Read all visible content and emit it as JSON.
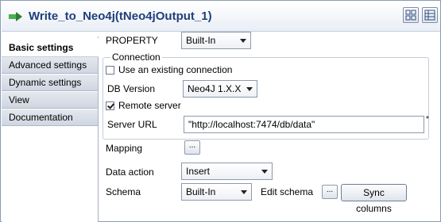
{
  "window": {
    "title": "Write_to_Neo4j(tNeo4jOutput_1)"
  },
  "tabs": [
    {
      "label": "Basic settings"
    },
    {
      "label": "Advanced settings"
    },
    {
      "label": "Dynamic settings"
    },
    {
      "label": "View"
    },
    {
      "label": "Documentation"
    }
  ],
  "property": {
    "label": "PROPERTY",
    "value": "Built-In"
  },
  "connection": {
    "group_title": "Connection",
    "use_existing_label": "Use an existing connection",
    "use_existing_checked": false,
    "db_version_label": "DB Version",
    "db_version_value": "Neo4J 1.X.X",
    "remote_server_label": "Remote server",
    "remote_server_checked": true,
    "server_url_label": "Server URL",
    "server_url_value": "\"http://localhost:7474/db/data\"",
    "required_mark": "*"
  },
  "mapping": {
    "label": "Mapping",
    "button": "..."
  },
  "data_action": {
    "label": "Data action",
    "value": "Insert"
  },
  "schema": {
    "label": "Schema",
    "value": "Built-In",
    "edit_label": "Edit schema",
    "edit_button": "...",
    "sync_button": "Sync columns"
  }
}
